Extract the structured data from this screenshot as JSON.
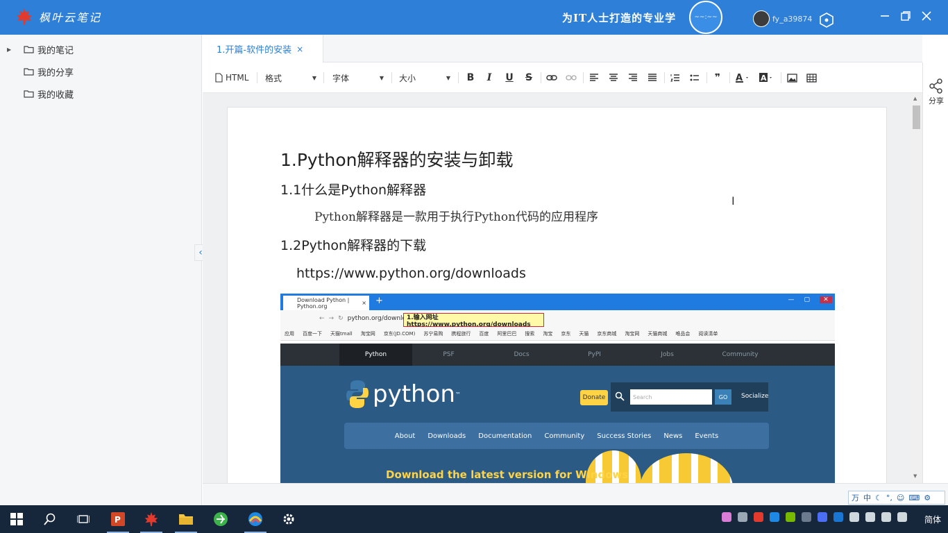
{
  "app": {
    "logo_text": "枫叶云笔记",
    "slogan": "为IT人士打造的专业学",
    "slogan_badge": "~~:~~",
    "username": "fy_a39874"
  },
  "sidebar": {
    "items": [
      {
        "label": "我的笔记",
        "expandable": true
      },
      {
        "label": "我的分享",
        "expandable": false
      },
      {
        "label": "我的收藏",
        "expandable": false
      }
    ]
  },
  "tabs": [
    {
      "label": "1.开篇-软件的安装",
      "close": "×",
      "active": true
    }
  ],
  "toolbar": {
    "html_label": "HTML",
    "format_label": "格式",
    "font_label": "字体",
    "size_label": "大小",
    "bold": "B",
    "italic": "I",
    "underline": "U",
    "strike": "S",
    "quote": "❞"
  },
  "document": {
    "h1": "1.Python解释器的安装与卸载",
    "h2_1": "1.1什么是Python解释器",
    "para_1": "Python解释器是一款用于执行Python代码的应用程序",
    "h2_2": "1.2Python解释器的下载",
    "link": "https://www.python.org/downloads"
  },
  "embedded_screenshot": {
    "browser_tab": "Download Python | Python.org",
    "tab_close": "×",
    "plus": "+",
    "address": "python.org/downloads/",
    "callout": "1.输入网址https://www.python.org/downloads",
    "bookmarks": [
      "应用",
      "百度一下",
      "天猫tmall",
      "淘宝网",
      "京东(JD.COM)",
      "苏宁易购",
      "携程旅行",
      "百度",
      "阿里巴巴",
      "搜索",
      "淘宝",
      "京东",
      "天猫",
      "京东商城",
      "淘宝网",
      "天猫商城",
      "唯品会",
      "阅读清单"
    ],
    "site_nav": [
      "Python",
      "PSF",
      "Docs",
      "PyPI",
      "Jobs",
      "Community"
    ],
    "logo_word": "python",
    "logo_tm": "™",
    "donate": "Donate",
    "search_placeholder": "Search",
    "go": "GO",
    "socialize": "Socialize",
    "menu": [
      "About",
      "Downloads",
      "Documentation",
      "Community",
      "Success Stories",
      "News",
      "Events"
    ],
    "download_heading": "Download the latest version for Windows"
  },
  "share": {
    "label": "分享"
  },
  "statusbar": {
    "ime_items": [
      "万",
      "中",
      "☾",
      "°,",
      "☺",
      "⌨",
      "⚙"
    ]
  },
  "taskbar": {
    "language": "简体"
  },
  "colors": {
    "brand": "#2d7fd7",
    "taskbar": "#16263b",
    "python_blue": "#2b5b84",
    "python_yellow": "#ffd343"
  }
}
